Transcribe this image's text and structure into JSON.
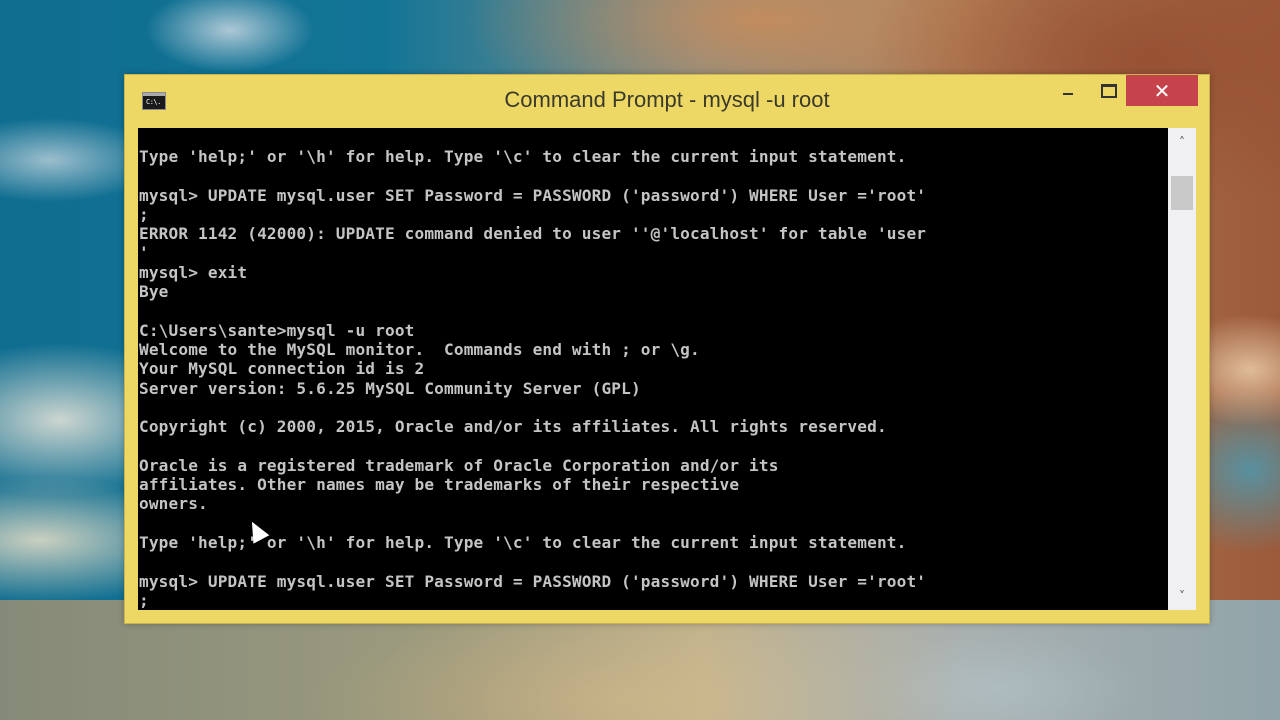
{
  "window": {
    "title": "Command Prompt - mysql  -u root",
    "icon": "cmd-icon",
    "icon_text": "C:\\.",
    "controls": {
      "minimize_icon": "minimize-icon",
      "maximize_icon": "maximize-icon",
      "close_icon": "close-icon",
      "close_glyph": "✕"
    }
  },
  "console": {
    "lines": [
      "Type 'help;' or '\\h' for help. Type '\\c' to clear the current input statement.",
      "",
      "mysql> UPDATE mysql.user SET Password = PASSWORD ('password') WHERE User ='root'",
      ";",
      "ERROR 1142 (42000): UPDATE command denied to user ''@'localhost' for table 'user",
      "'",
      "mysql> exit",
      "Bye",
      "",
      "C:\\Users\\sante>mysql -u root",
      "Welcome to the MySQL monitor.  Commands end with ; or \\g.",
      "Your MySQL connection id is 2",
      "Server version: 5.6.25 MySQL Community Server (GPL)",
      "",
      "Copyright (c) 2000, 2015, Oracle and/or its affiliates. All rights reserved.",
      "",
      "Oracle is a registered trademark of Oracle Corporation and/or its",
      "affiliates. Other names may be trademarks of their respective",
      "owners.",
      "",
      "Type 'help;' or '\\h' for help. Type '\\c' to clear the current input statement.",
      "",
      "mysql> UPDATE mysql.user SET Password = PASSWORD ('password') WHERE User ='root'",
      ";"
    ]
  },
  "scrollbar": {
    "up_glyph": "˄",
    "down_glyph": "˅",
    "position_fraction": 0.05
  },
  "colors": {
    "window_frame": "#eed865",
    "close_button": "#c7434b",
    "console_bg": "#000000",
    "console_text": "#c4c4c4"
  }
}
